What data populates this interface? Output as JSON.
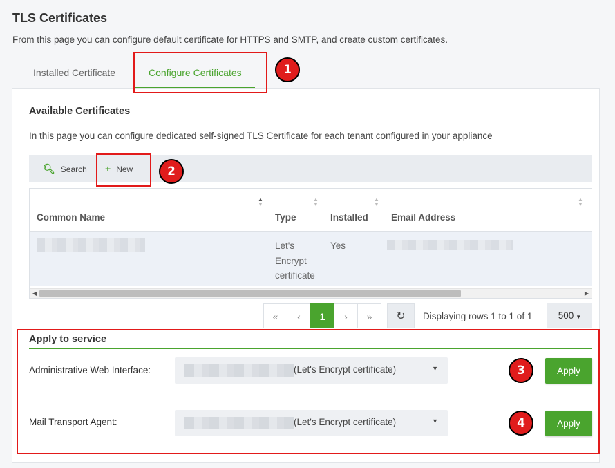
{
  "page": {
    "title": "TLS Certificates",
    "description": "From this page you can configure default certificate for HTTPS and SMTP, and create custom certificates."
  },
  "tabs": [
    {
      "label": "Installed Certificate",
      "active": false
    },
    {
      "label": "Configure Certificates",
      "active": true
    }
  ],
  "available": {
    "title": "Available Certificates",
    "description": "In this page you can configure dedicated self-signed TLS Certificate for each tenant configured in your appliance",
    "toolbar": {
      "search_label": "Search",
      "new_label": "New",
      "search_icon": "search-icon",
      "new_icon": "plus-icon"
    },
    "table": {
      "columns": [
        "Common Name",
        "Type",
        "Installed",
        "Email Address"
      ],
      "rows": [
        {
          "common_name": "",
          "type": "Let's Encrypt certificate",
          "installed": "Yes",
          "email": ""
        }
      ]
    },
    "pagination": {
      "pages": [
        "«",
        "‹",
        "1",
        "›",
        "»"
      ],
      "current": "1",
      "rows_info": "Displaying rows 1 to 1 of 1",
      "per_page": "500"
    }
  },
  "apply": {
    "title": "Apply to service",
    "services": [
      {
        "label": "Administrative Web Interface:",
        "selected": "(Let's Encrypt certificate)",
        "button": "Apply"
      },
      {
        "label": "Mail Transport Agent:",
        "selected": "(Let's Encrypt certificate)",
        "button": "Apply"
      }
    ]
  },
  "annotations": [
    "1",
    "2",
    "3",
    "4"
  ],
  "colors": {
    "accent": "#4aa42e",
    "highlight": "#e21a1a",
    "marker": "#e01c1c"
  }
}
